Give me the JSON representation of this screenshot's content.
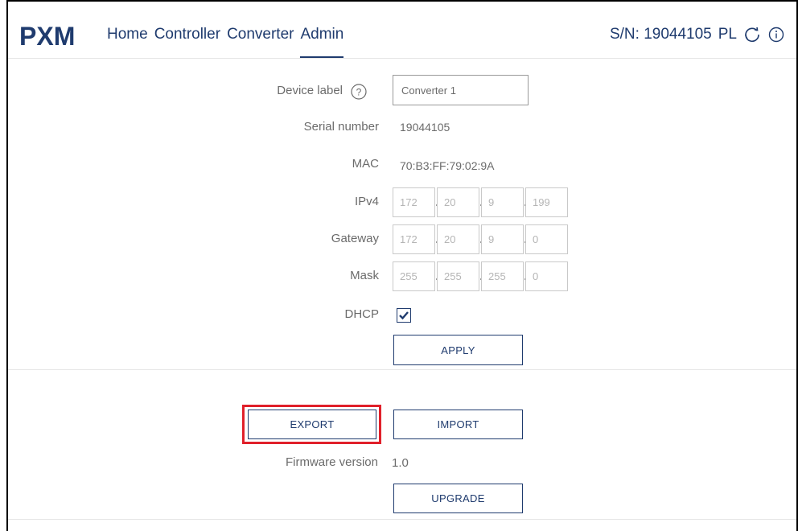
{
  "header": {
    "brand": "PXM",
    "nav": [
      {
        "label": "Home"
      },
      {
        "label": "Controller"
      },
      {
        "label": "Converter"
      },
      {
        "label": "Admin"
      }
    ],
    "active_tab": "Admin",
    "serial_text": "S/N: 19044105",
    "language": "PL",
    "icons": [
      "refresh-icon",
      "info-icon"
    ]
  },
  "form": {
    "device_label": {
      "label": "Device label",
      "value": "Converter 1"
    },
    "serial": {
      "label": "Serial number",
      "value": "19044105"
    },
    "mac": {
      "label": "MAC",
      "value": "70:B3:FF:79:02:9A"
    },
    "ipv4": {
      "label": "IPv4",
      "octets": [
        "172",
        "20",
        "9",
        "199"
      ]
    },
    "gateway": {
      "label": "Gateway",
      "octets": [
        "172",
        "20",
        "9",
        "0"
      ]
    },
    "mask": {
      "label": "Mask",
      "octets": [
        "255",
        "255",
        "255",
        "0"
      ]
    },
    "dhcp": {
      "label": "DHCP",
      "checked": true
    },
    "apply_label": "APPLY"
  },
  "config": {
    "export_label": "EXPORT",
    "import_label": "IMPORT"
  },
  "firmware": {
    "label": "Firmware version",
    "value": "1.0",
    "upgrade_label": "UPGRADE"
  },
  "colors": {
    "brand": "#1f3b6e",
    "highlight": "#e0202a"
  }
}
